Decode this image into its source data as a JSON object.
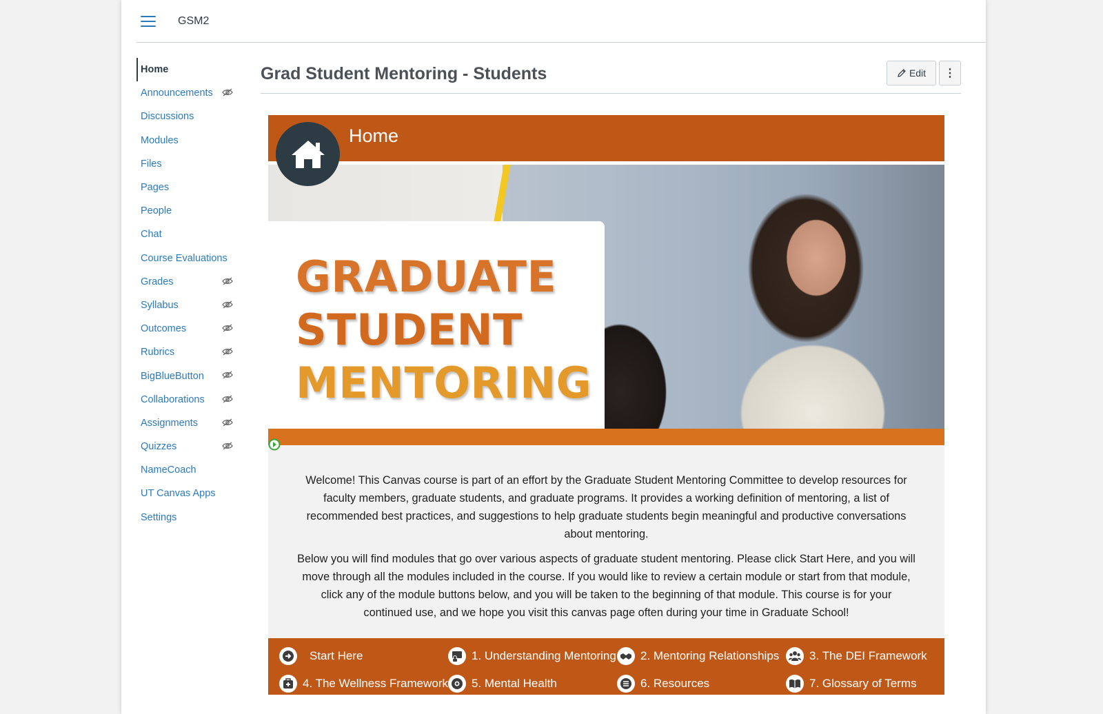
{
  "topbar": {
    "course_code": "GSM2"
  },
  "nav": {
    "items": [
      {
        "label": "Home",
        "active": true,
        "hidden": false
      },
      {
        "label": "Announcements",
        "hidden": true
      },
      {
        "label": "Discussions",
        "hidden": false
      },
      {
        "label": "Modules",
        "hidden": false
      },
      {
        "label": "Files",
        "hidden": false
      },
      {
        "label": "Pages",
        "hidden": false
      },
      {
        "label": "People",
        "hidden": false
      },
      {
        "label": "Chat",
        "hidden": false
      },
      {
        "label": "Course Evaluations",
        "hidden": false
      },
      {
        "label": "Grades",
        "hidden": true
      },
      {
        "label": "Syllabus",
        "hidden": true
      },
      {
        "label": "Outcomes",
        "hidden": true
      },
      {
        "label": "Rubrics",
        "hidden": true
      },
      {
        "label": "BigBlueButton",
        "hidden": true
      },
      {
        "label": "Collaborations",
        "hidden": true
      },
      {
        "label": "Assignments",
        "hidden": true
      },
      {
        "label": "Quizzes",
        "hidden": true
      },
      {
        "label": "NameCoach",
        "hidden": false
      },
      {
        "label": "UT Canvas Apps",
        "hidden": false
      },
      {
        "label": "Settings",
        "hidden": false
      }
    ]
  },
  "page": {
    "title": "Grad Student Mentoring - Students",
    "edit_label": "Edit",
    "more_label": "⋮"
  },
  "banner": {
    "home_title": "Home",
    "hero_lines": [
      "GRADUATE",
      "STUDENT",
      "MENTORING"
    ]
  },
  "welcome": {
    "p1": "Welcome! This Canvas course is part of an effort by the Graduate Student Mentoring Committee to develop resources for faculty members, graduate students, and graduate programs. It provides a working definition of mentoring, a list of recommended best practices, and suggestions to help graduate students begin meaningful and productive conversations about mentoring.",
    "p2": "Below you will find modules that go over various aspects of graduate student mentoring. Please click Start Here, and you will move through all the modules included in the course. If you would like to review a certain module or start from that module, click any of the module buttons below, and you will be taken to the beginning of that module. This course is for your continued use, and we hope you visit this canvas page often during your time in Graduate School!"
  },
  "modules": [
    {
      "label": "Start Here",
      "icon": "arrow-right-icon"
    },
    {
      "label": "1. Understanding Mentoring",
      "icon": "presenter-icon"
    },
    {
      "label": "2. Mentoring Relationships",
      "icon": "handshake-icon"
    },
    {
      "label": "3. The DEI Framework",
      "icon": "people-icon"
    },
    {
      "label": "4. The Wellness Framework",
      "icon": "first-aid-icon"
    },
    {
      "label": "5. Mental Health",
      "icon": "brain-icon"
    },
    {
      "label": "6. Resources",
      "icon": "document-icon"
    },
    {
      "label": "7. Glossary of Terms",
      "icon": "book-icon"
    }
  ],
  "colors": {
    "link": "#2b7abc",
    "brand_orange": "#bf5817",
    "strip_orange": "#d8721f",
    "home_circle": "#2d3b45"
  }
}
